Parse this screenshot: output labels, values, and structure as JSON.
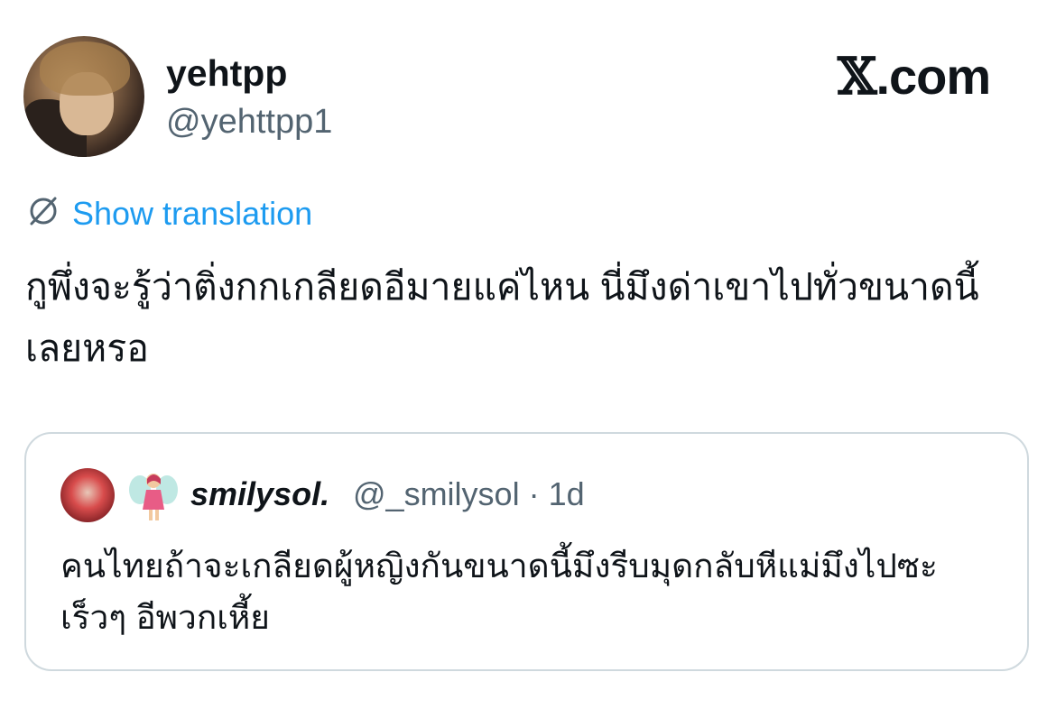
{
  "author": {
    "display_name": "yehtpp",
    "handle": "@yehttpp1"
  },
  "brand": {
    "x_mark": "𝕏",
    "suffix": ".com"
  },
  "translation": {
    "icon": "translate-globe-icon",
    "label": "Show translation"
  },
  "tweet": {
    "text": "กูพึ่งจะรู้ว่าติ่งกกเกลียดอีมายแค่ไหน นี่มึงด่าเขาไปทั่วขนาดนี้เลยหรอ"
  },
  "quoted_tweet": {
    "display_name": "smilysol.",
    "handle": "@_smilysol",
    "separator": "·",
    "time": "1d",
    "emoji_icon": "fairy-icon",
    "text": "คนไทยถ้าจะเกลียดผู้หญิงกันขนาดนี้มึงรีบมุดกลับหีแม่มึงไปซะเร็วๆ อีพวกเหี้ย"
  },
  "colors": {
    "link": "#1d9bf0",
    "secondary_text": "#536471",
    "border": "#cfd9de",
    "primary_text": "#0f1419"
  }
}
